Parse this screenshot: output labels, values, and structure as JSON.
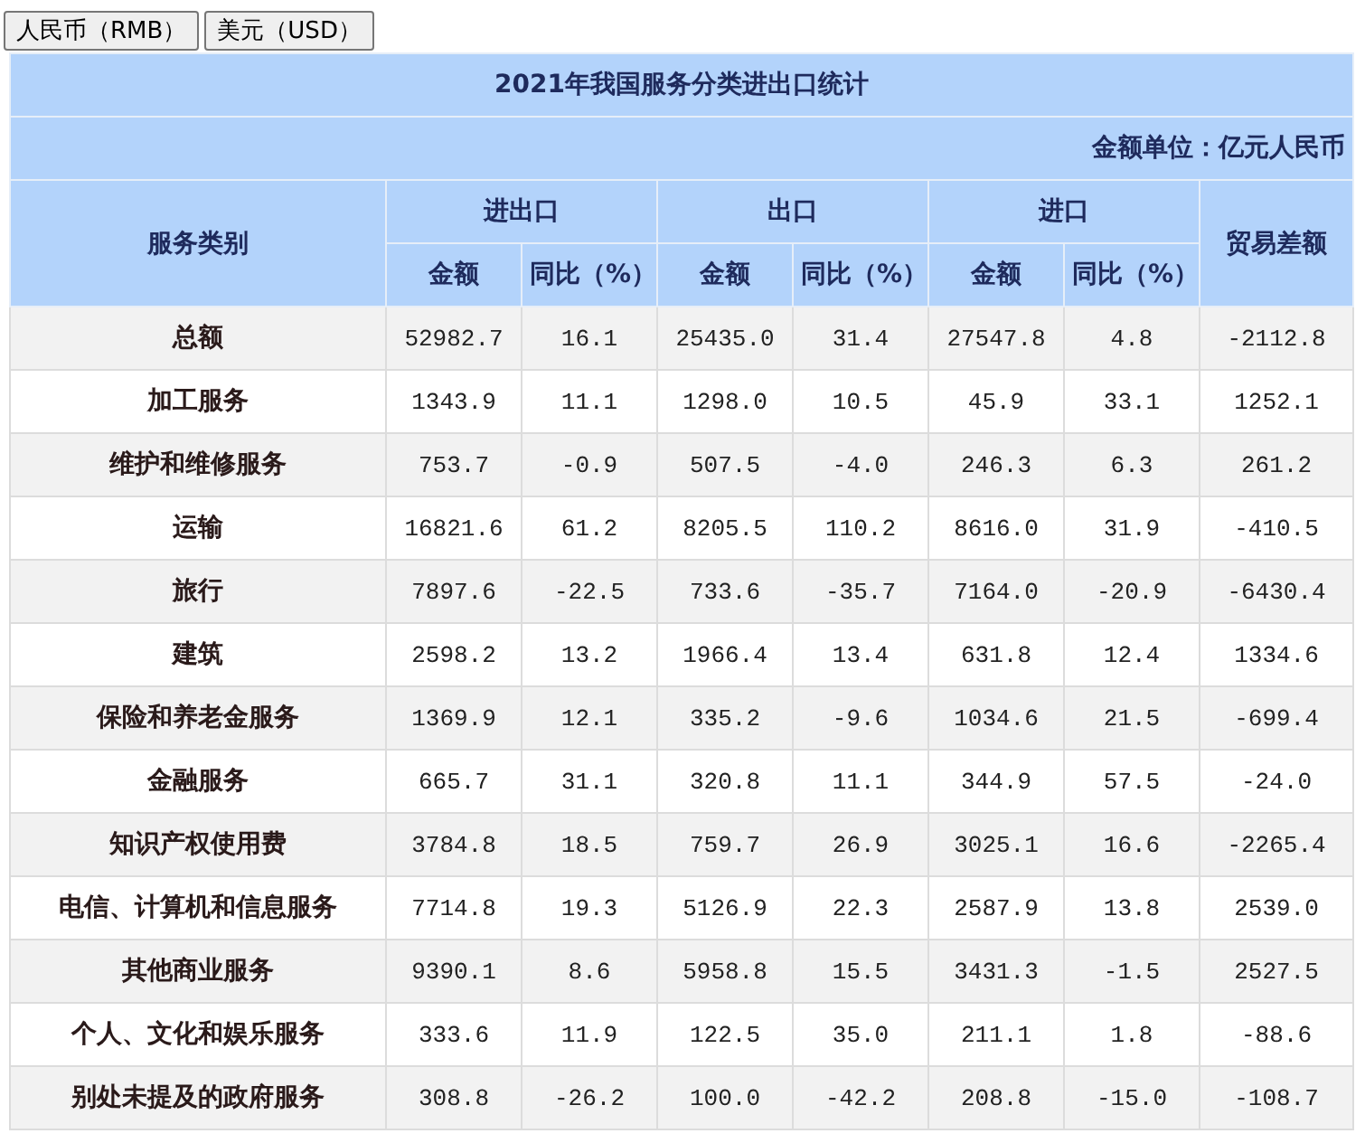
{
  "currency_buttons": [
    "人民币（RMB）",
    "美元（USD）"
  ],
  "table": {
    "title": "2021年我国服务分类进出口统计",
    "unit": "金额单位：亿元人民币",
    "row_header": "服务类别",
    "groups": [
      "进出口",
      "出口",
      "进口"
    ],
    "balance_header": "贸易差额",
    "sub_headers": [
      "金额",
      "同比（%）",
      "金额",
      "同比（%）",
      "金额",
      "同比（%）"
    ],
    "rows": [
      {
        "category": "总额",
        "values": [
          "52982.7",
          "16.1",
          "25435.0",
          "31.4",
          "27547.8",
          "4.8",
          "-2112.8"
        ]
      },
      {
        "category": "加工服务",
        "values": [
          "1343.9",
          "11.1",
          "1298.0",
          "10.5",
          "45.9",
          "33.1",
          "1252.1"
        ]
      },
      {
        "category": "维护和维修服务",
        "values": [
          "753.7",
          "-0.9",
          "507.5",
          "-4.0",
          "246.3",
          "6.3",
          "261.2"
        ]
      },
      {
        "category": "运输",
        "values": [
          "16821.6",
          "61.2",
          "8205.5",
          "110.2",
          "8616.0",
          "31.9",
          "-410.5"
        ]
      },
      {
        "category": "旅行",
        "values": [
          "7897.6",
          "-22.5",
          "733.6",
          "-35.7",
          "7164.0",
          "-20.9",
          "-6430.4"
        ]
      },
      {
        "category": "建筑",
        "values": [
          "2598.2",
          "13.2",
          "1966.4",
          "13.4",
          "631.8",
          "12.4",
          "1334.6"
        ]
      },
      {
        "category": "保险和养老金服务",
        "values": [
          "1369.9",
          "12.1",
          "335.2",
          "-9.6",
          "1034.6",
          "21.5",
          "-699.4"
        ]
      },
      {
        "category": "金融服务",
        "values": [
          "665.7",
          "31.1",
          "320.8",
          "11.1",
          "344.9",
          "57.5",
          "-24.0"
        ]
      },
      {
        "category": "知识产权使用费",
        "values": [
          "3784.8",
          "18.5",
          "759.7",
          "26.9",
          "3025.1",
          "16.6",
          "-2265.4"
        ]
      },
      {
        "category": "电信、计算机和信息服务",
        "values": [
          "7714.8",
          "19.3",
          "5126.9",
          "22.3",
          "2587.9",
          "13.8",
          "2539.0"
        ]
      },
      {
        "category": "其他商业服务",
        "values": [
          "9390.1",
          "8.6",
          "5958.8",
          "15.5",
          "3431.3",
          "-1.5",
          "2527.5"
        ]
      },
      {
        "category": "个人、文化和娱乐服务",
        "values": [
          "333.6",
          "11.9",
          "122.5",
          "35.0",
          "211.1",
          "1.8",
          "-88.6"
        ]
      },
      {
        "category": "别处未提及的政府服务",
        "values": [
          "308.8",
          "-26.2",
          "100.0",
          "-42.2",
          "208.8",
          "-15.0",
          "-108.7"
        ]
      }
    ]
  }
}
